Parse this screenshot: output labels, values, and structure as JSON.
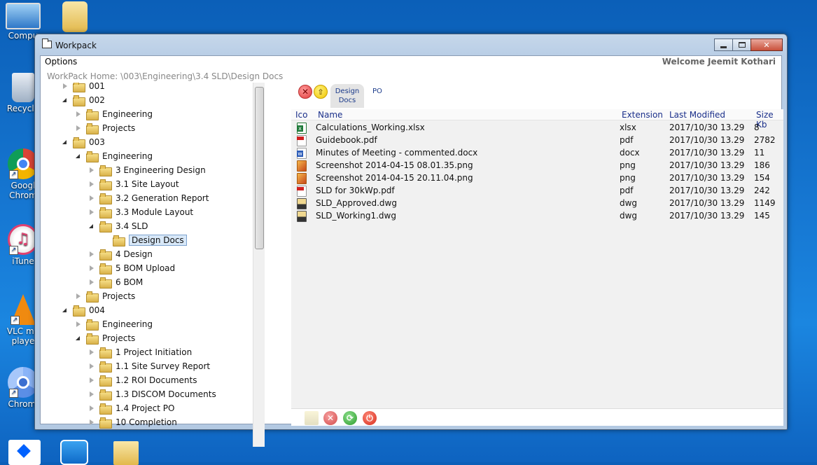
{
  "desktop": {
    "icons": [
      {
        "label": "Compu",
        "name": "computer"
      },
      {
        "label": "Recycle",
        "name": "recycle-bin"
      },
      {
        "label": "Googl Chrom",
        "name": "chrome"
      },
      {
        "label": "iTune",
        "name": "itunes"
      },
      {
        "label": "VLC me playe",
        "name": "vlc"
      },
      {
        "label": "Chromi",
        "name": "chromium"
      }
    ]
  },
  "window": {
    "title": "Workpack",
    "controls": {
      "minimize": "—",
      "maximize": "□",
      "close": "✕"
    }
  },
  "menubar": {
    "options": "Options",
    "welcome": "Welcome Jeemit Kothari"
  },
  "breadcrumb": "WorkPack Home: \\003\\Engineering\\3.4 SLD\\Design Docs",
  "tree": [
    {
      "label": "001",
      "level": 0,
      "state": "collapsed"
    },
    {
      "label": "002",
      "level": 0,
      "state": "expanded"
    },
    {
      "label": "Engineering",
      "level": 1,
      "state": "collapsed"
    },
    {
      "label": "Projects",
      "level": 1,
      "state": "collapsed"
    },
    {
      "label": "003",
      "level": 0,
      "state": "expanded"
    },
    {
      "label": "Engineering",
      "level": 1,
      "state": "expanded"
    },
    {
      "label": "3 Engineering Design",
      "level": 2,
      "state": "collapsed"
    },
    {
      "label": "3.1 Site Layout",
      "level": 2,
      "state": "collapsed"
    },
    {
      "label": "3.2 Generation Report",
      "level": 2,
      "state": "collapsed"
    },
    {
      "label": "3.3 Module Layout",
      "level": 2,
      "state": "collapsed"
    },
    {
      "label": "3.4 SLD",
      "level": 2,
      "state": "expanded"
    },
    {
      "label": "Design Docs",
      "level": 3,
      "state": "none",
      "selected": true
    },
    {
      "label": "4 Design",
      "level": 2,
      "state": "collapsed"
    },
    {
      "label": "5 BOM Upload",
      "level": 2,
      "state": "collapsed"
    },
    {
      "label": "6 BOM",
      "level": 2,
      "state": "collapsed"
    },
    {
      "label": "Projects",
      "level": 1,
      "state": "collapsed"
    },
    {
      "label": "004",
      "level": 0,
      "state": "expanded"
    },
    {
      "label": "Engineering",
      "level": 1,
      "state": "collapsed"
    },
    {
      "label": "Projects",
      "level": 1,
      "state": "expanded"
    },
    {
      "label": "1 Project Initiation",
      "level": 2,
      "state": "collapsed"
    },
    {
      "label": "1.1 Site Survey Report",
      "level": 2,
      "state": "collapsed"
    },
    {
      "label": "1.2 ROI Documents",
      "level": 2,
      "state": "collapsed"
    },
    {
      "label": "1.3 DISCOM Documents",
      "level": 2,
      "state": "collapsed"
    },
    {
      "label": "1.4 Project PO",
      "level": 2,
      "state": "collapsed"
    },
    {
      "label": "10 Completion",
      "level": 2,
      "state": "collapsed"
    }
  ],
  "toolbar": {
    "close_symbol": "✕",
    "up_symbol": "⇧",
    "tabs": [
      {
        "label": "Design Docs",
        "active": true
      },
      {
        "label": "PO",
        "active": false
      }
    ]
  },
  "filelist": {
    "headers": {
      "ico": "Ico",
      "name": "Name",
      "extension": "Extension",
      "modified": "Last Modified",
      "size": "Size Kb"
    },
    "rows": [
      {
        "icon": "xlsx",
        "name": "Calculations_Working.xlsx",
        "ext": "xlsx",
        "modified": "2017/10/30  13.29",
        "size": "8"
      },
      {
        "icon": "pdf",
        "name": "Guidebook.pdf",
        "ext": "pdf",
        "modified": "2017/10/30  13.29",
        "size": "2782"
      },
      {
        "icon": "docx",
        "name": "Minutes of Meeting - commented.docx",
        "ext": "docx",
        "modified": "2017/10/30  13.29",
        "size": "11"
      },
      {
        "icon": "png",
        "name": "Screenshot 2014-04-15 08.01.35.png",
        "ext": "png",
        "modified": "2017/10/30  13.29",
        "size": "186"
      },
      {
        "icon": "png",
        "name": "Screenshot 2014-04-15 20.11.04.png",
        "ext": "png",
        "modified": "2017/10/30  13.29",
        "size": "154"
      },
      {
        "icon": "pdf",
        "name": "SLD for 30kWp.pdf",
        "ext": "pdf",
        "modified": "2017/10/30  13.29",
        "size": "242"
      },
      {
        "icon": "dwg",
        "name": "SLD_Approved.dwg",
        "ext": "dwg",
        "modified": "2017/10/30  13.29",
        "size": "1149"
      },
      {
        "icon": "dwg",
        "name": "SLD_Working1.dwg",
        "ext": "dwg",
        "modified": "2017/10/30  13.29",
        "size": "145"
      }
    ]
  },
  "bottombar": {
    "cancel_symbol": "✕",
    "sync_symbol": "⟳",
    "power_symbol": "⏻"
  }
}
